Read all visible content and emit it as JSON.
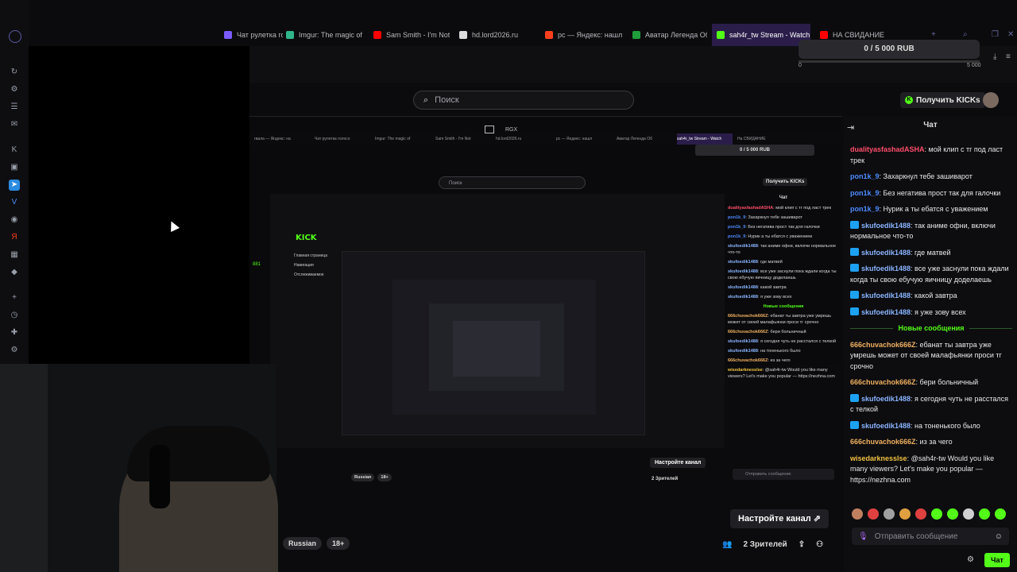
{
  "browser": {
    "tabs": [
      {
        "label": "Чат рулетка голосо",
        "fav": "#7a5af8",
        "active": false
      },
      {
        "label": "Imgur: The magic of",
        "fav": "#2fb58a",
        "active": false
      },
      {
        "label": "Sam Smith - I'm Not",
        "fav": "#ff0000",
        "active": false
      },
      {
        "label": "hd.lord2026.ru",
        "fav": "#dddddd",
        "active": false
      },
      {
        "label": "рс — Яндекс: нашл",
        "fav": "#fc3f1d",
        "active": false
      },
      {
        "label": "Аватар Легенда Об",
        "fav": "#1f9e3a",
        "active": false
      },
      {
        "label": "sah4r_tw Stream - Watch",
        "fav": "#53fc18",
        "active": true
      },
      {
        "label": "НА СВИДАНИЕ",
        "fav": "#ff0000",
        "active": false
      }
    ],
    "new_tab": "+"
  },
  "sidebar_icons": [
    "history-icon",
    "robot-icon",
    "checklist-icon",
    "mail-icon",
    "kick-icon",
    "twitch-icon",
    "telegram-icon",
    "vk-icon",
    "discord-icon",
    "yandex-icon",
    "photo-icon",
    "game-icon",
    "add-icon",
    "clock-icon",
    "puzzle-icon",
    "settings-icon"
  ],
  "goal": {
    "text": "0 / 5 000 RUB",
    "min": "0",
    "max": "5 000",
    "progress": 0.0
  },
  "search": {
    "placeholder": "Поиск"
  },
  "kicks_button": "Получить KICKs",
  "chat": {
    "title": "Чат",
    "messages": [
      {
        "user": "dualityasfashadASHA",
        "color": "#ff4d6a",
        "badge": false,
        "text": "мой клип с тг под ласт трек"
      },
      {
        "user": "pon1k_9",
        "color": "#4d8bff",
        "badge": false,
        "text": "Захаркнул тебе зашиварот"
      },
      {
        "user": "pon1k_9",
        "color": "#4d8bff",
        "badge": false,
        "text": "Без негатива прост так для галочки"
      },
      {
        "user": "pon1k_9",
        "color": "#4d8bff",
        "badge": false,
        "text": "Нурик а ты ебатся с уважением"
      },
      {
        "user": "skufoedik1488",
        "color": "#8ab4ff",
        "badge": true,
        "text": "так аниме офни, включи нормальное что-то"
      },
      {
        "user": "skufoedik1488",
        "color": "#8ab4ff",
        "badge": true,
        "text": "где матвей"
      },
      {
        "user": "skufoedik1488",
        "color": "#8ab4ff",
        "badge": true,
        "text": "все уже заснули пока ждали когда ты свою ебучую яичницу доделаешь"
      },
      {
        "user": "skufoedik1488",
        "color": "#8ab4ff",
        "badge": true,
        "text": "какой завтра"
      },
      {
        "user": "skufoedik1488",
        "color": "#8ab4ff",
        "badge": true,
        "text": "я уже зову всех"
      }
    ],
    "divider": "Новые сообщения",
    "new_messages": [
      {
        "user": "666chuvachok666Z",
        "color": "#f0b060",
        "badge": false,
        "text": "ебанат ты завтра уже умрешь может от своей малафьянки проси тг срочно"
      },
      {
        "user": "666chuvachok666Z",
        "color": "#f0b060",
        "badge": false,
        "text": "бери больничный"
      },
      {
        "user": "skufoedik1488",
        "color": "#8ab4ff",
        "badge": true,
        "text": "я сегодня чуть не расстался с телкой"
      },
      {
        "user": "skufoedik1488",
        "color": "#8ab4ff",
        "badge": true,
        "text": "на тоненького было"
      },
      {
        "user": "666chuvachok666Z",
        "color": "#f0b060",
        "badge": false,
        "text": "из за чего"
      },
      {
        "user": "wisedarknesslse",
        "color": "#f0c040",
        "badge": false,
        "text": "@sah4r-tw Would you like many viewers? Let's make you popular — https://nezhna.com"
      }
    ],
    "emote_colors": [
      "#c08060",
      "#e04040",
      "#a0a0a0",
      "#e0a040",
      "#e04040",
      "#53fc18",
      "#53fc18",
      "#d0d0d0",
      "#53fc18",
      "#53fc18"
    ],
    "send_placeholder": "Отправить сообщение",
    "send_button": "Чат"
  },
  "stream": {
    "tags": [
      "Russian",
      "18+"
    ],
    "configure_channel": "Настройте канал",
    "viewers": "2 Зрителей",
    "viewers_count": "2",
    "rgx_label": "RGX"
  },
  "inner": {
    "search": "Поиск",
    "goal": "0 / 5 000 RUB",
    "kicks": "Получить KICKs",
    "chat_title": "Чат",
    "tabs": [
      "гвала — Яндекс: на",
      "Чат рулетка голосо",
      "Imgur: The magic of",
      "Sam Smith - I'm Not",
      "hd.lord2026.ru",
      "рс — Яндекс: нашл",
      "Аватар Легенда Об",
      "sah4r_tw Stream - Watch",
      "На СВИДАНИЕ"
    ],
    "lines": [
      {
        "u": "dualityasfashadASHA",
        "t": "мой клип с тг под ласт трек",
        "c": "#ff4d6a"
      },
      {
        "u": "pon1k_9",
        "t": "Захаркнул тебе зашиварот",
        "c": "#4d8bff"
      },
      {
        "u": "pon1k_9",
        "t": "Без негатива прост так для галочки",
        "c": "#4d8bff"
      },
      {
        "u": "pon1k_9",
        "t": "Нурик а ты ебатся с уважением",
        "c": "#4d8bff"
      },
      {
        "u": "skufoedik1488",
        "t": "так аниме офни, включи нормальное что-то",
        "c": "#8ab4ff"
      },
      {
        "u": "skufoedik1488",
        "t": "где матвей",
        "c": "#8ab4ff"
      },
      {
        "u": "skufoedik1488",
        "t": "все уже заснули пока ждали когда ты свою ебучую яичницу доделаешь",
        "c": "#8ab4ff"
      },
      {
        "u": "skufoedik1488",
        "t": "какой завтра",
        "c": "#8ab4ff"
      },
      {
        "u": "skufoedik1488",
        "t": "я уже зову всех",
        "c": "#8ab4ff"
      }
    ],
    "divider": "Новые сообщения",
    "new_lines": [
      {
        "u": "666chuvachok666Z",
        "t": "ебанат ты завтра уже умрешь может от своей малафьянки проси тг срочно",
        "c": "#f0b060"
      },
      {
        "u": "666chuvachok666Z",
        "t": "бери больничный",
        "c": "#f0b060"
      },
      {
        "u": "skufoedik1488",
        "t": "я сегодня чуть не расстался с телкой",
        "c": "#8ab4ff"
      },
      {
        "u": "skufoedik1488",
        "t": "на тоненького было",
        "c": "#8ab4ff"
      },
      {
        "u": "666chuvachok666Z",
        "t": "из за чего",
        "c": "#f0b060"
      },
      {
        "u": "wisedarknesslse",
        "t": "@sah4r-tw Would you like many viewers? Let's make you popular — https://nezhna.com",
        "c": "#f0c040"
      }
    ],
    "send": "Отправить сообщение",
    "configure": "Настройте канал",
    "viewers": "2 Зрителей",
    "tags": [
      "Russian",
      "18+"
    ],
    "deep_logo": "KICK",
    "deep_nav": [
      "Главная страница",
      "Навигация",
      "Отслеживаемое"
    ],
    "deep_count": "881"
  }
}
